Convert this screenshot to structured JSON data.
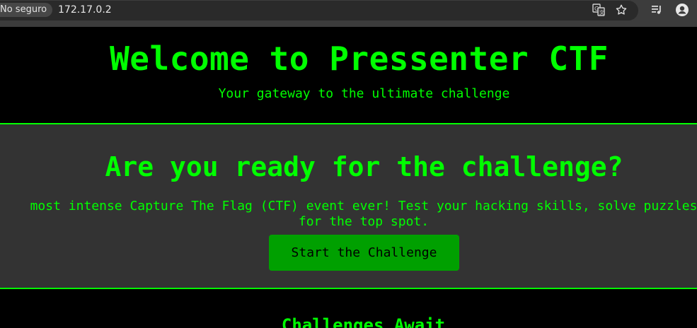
{
  "browser": {
    "security_label": "No seguro",
    "url": "172.17.0.2",
    "icons": {
      "translate": "translate-icon",
      "bookmark": "star-icon",
      "media": "media-queue-icon",
      "profile": "profile-icon"
    }
  },
  "header": {
    "title": "Welcome to Pressenter CTF",
    "subtitle": "Your gateway to the ultimate challenge"
  },
  "hero": {
    "title": "Are you ready for the challenge?",
    "text_line1": "most intense Capture The Flag (CTF) event ever! Test your hacking skills, solve puzzles",
    "text_line2": "for the top spot.",
    "button_label": "Start the Challenge"
  },
  "challenges": {
    "title": "Challenges Await"
  },
  "colors": {
    "accent": "#00ff00",
    "button": "#00a000",
    "hero_background": "#333333",
    "page_background": "#000000"
  }
}
